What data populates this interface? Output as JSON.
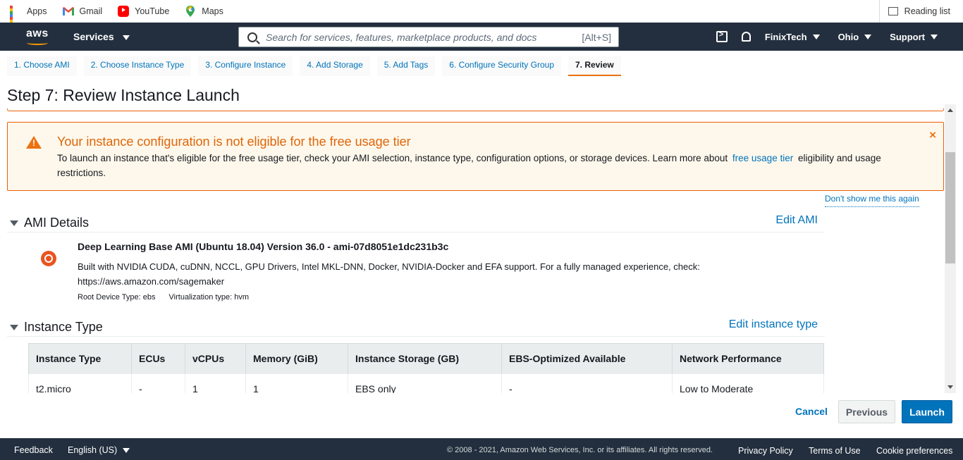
{
  "bookmarks": {
    "items": [
      {
        "label": "Apps",
        "icon": "apps-grid-icon"
      },
      {
        "label": "Gmail",
        "icon": "gmail-icon"
      },
      {
        "label": "YouTube",
        "icon": "youtube-icon"
      },
      {
        "label": "Maps",
        "icon": "maps-icon"
      }
    ],
    "reading_list": "Reading list"
  },
  "header": {
    "logo": "aws",
    "services": "Services",
    "search_placeholder": "Search for services, features, marketplace products, and docs",
    "search_shortcut": "[Alt+S]",
    "account": "FinixTech",
    "region": "Ohio",
    "support": "Support"
  },
  "wizard": {
    "tabs": [
      "1. Choose AMI",
      "2. Choose Instance Type",
      "3. Configure Instance",
      "4. Add Storage",
      "5. Add Tags",
      "6. Configure Security Group",
      "7. Review"
    ],
    "active_tab": "7. Review"
  },
  "page": {
    "title": "Step 7: Review Instance Launch"
  },
  "alert": {
    "title": "Your instance configuration is not eligible for the free usage tier",
    "text_before": "To launch an instance that's eligible for the free usage tier, check your AMI selection, instance type, configuration options, or storage devices. Learn more about",
    "link": "free usage tier",
    "text_after": "eligibility and usage restrictions.",
    "close": "×",
    "dont_show": "Don't show me this again",
    "color": "#ec7211"
  },
  "ami_section": {
    "title": "AMI Details",
    "edit": "Edit AMI",
    "name": "Deep Learning Base AMI (Ubuntu 18.04) Version 36.0 - ami-07d8051e1dc231b3c",
    "description": "Built with NVIDIA CUDA, cuDNN, NCCL, GPU Drivers, Intel MKL-DNN, Docker, NVIDIA-Docker and EFA support. For a fully managed experience, check: https://aws.amazon.com/sagemaker",
    "root_device": "Root Device Type: ebs",
    "virtualization": "Virtualization type: hvm"
  },
  "instance_section": {
    "title": "Instance Type",
    "edit": "Edit instance type",
    "columns": [
      "Instance Type",
      "ECUs",
      "vCPUs",
      "Memory (GiB)",
      "Instance Storage (GB)",
      "EBS-Optimized Available",
      "Network Performance"
    ],
    "rows": [
      [
        "t2.micro",
        "-",
        "1",
        "1",
        "EBS only",
        "-",
        "Low to Moderate"
      ]
    ]
  },
  "actions": {
    "cancel": "Cancel",
    "previous": "Previous",
    "launch": "Launch"
  },
  "footer": {
    "feedback": "Feedback",
    "language": "English (US)",
    "copyright": "© 2008 - 2021, Amazon Web Services, Inc. or its affiliates. All rights reserved.",
    "privacy": "Privacy Policy",
    "terms": "Terms of Use",
    "cookies": "Cookie preferences"
  }
}
